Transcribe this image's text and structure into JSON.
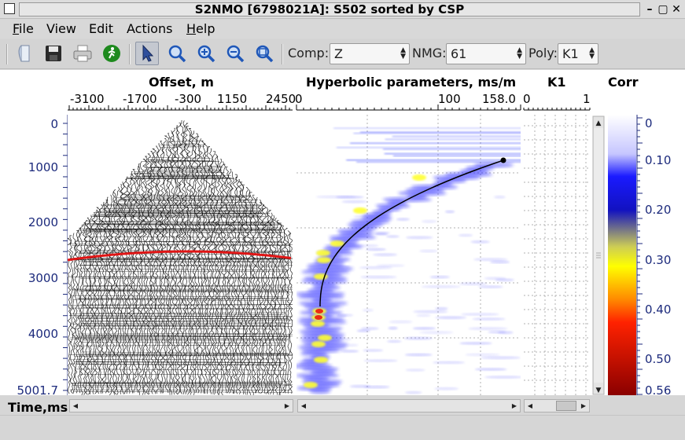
{
  "window": {
    "title": "S2NMO [6798021A]: S502 sorted by CSP",
    "minimize": "–",
    "maximize": "▢",
    "close": "✕"
  },
  "menu": [
    {
      "label": "File",
      "u": "F",
      "rest": "ile"
    },
    {
      "label": "View"
    },
    {
      "label": "Edit"
    },
    {
      "label": "Actions"
    },
    {
      "label": "Help",
      "u": "H",
      "rest": "elp"
    }
  ],
  "toolbar": {
    "comp_label": "Comp:",
    "comp_value": "Z",
    "nmg_label": "NMG:",
    "nmg_value": "61",
    "poly_label": "Poly:",
    "poly_value": "K1"
  },
  "panels": {
    "offset_title": "Offset, m",
    "offset_ticks": [
      "-3100",
      "-1700",
      "-300",
      "1150",
      "2450"
    ],
    "hyper_title": "Hyperbolic parameters, ms/m",
    "hyper_ticks": [
      "0",
      "100",
      "158.0"
    ],
    "k1_title": "K1",
    "k1_ticks": [
      "0",
      "1"
    ],
    "corr_title": "Corr",
    "corr_ticks": [
      "0",
      "0.10",
      "0.20",
      "0.30",
      "0.40",
      "0.50",
      "0.56"
    ],
    "time_ticks": [
      "0",
      "1000",
      "2000",
      "3000",
      "4000",
      "5001.7"
    ],
    "time_axis_label": "Time,ms"
  },
  "colors": {
    "axis_text": "#1c2a7c",
    "nmo_curve": "#e01515",
    "pick_curve": "#000000",
    "colormap": [
      "#ffffff",
      "#1a1aff",
      "#ffff00",
      "#ff2200",
      "#8a0000"
    ]
  }
}
